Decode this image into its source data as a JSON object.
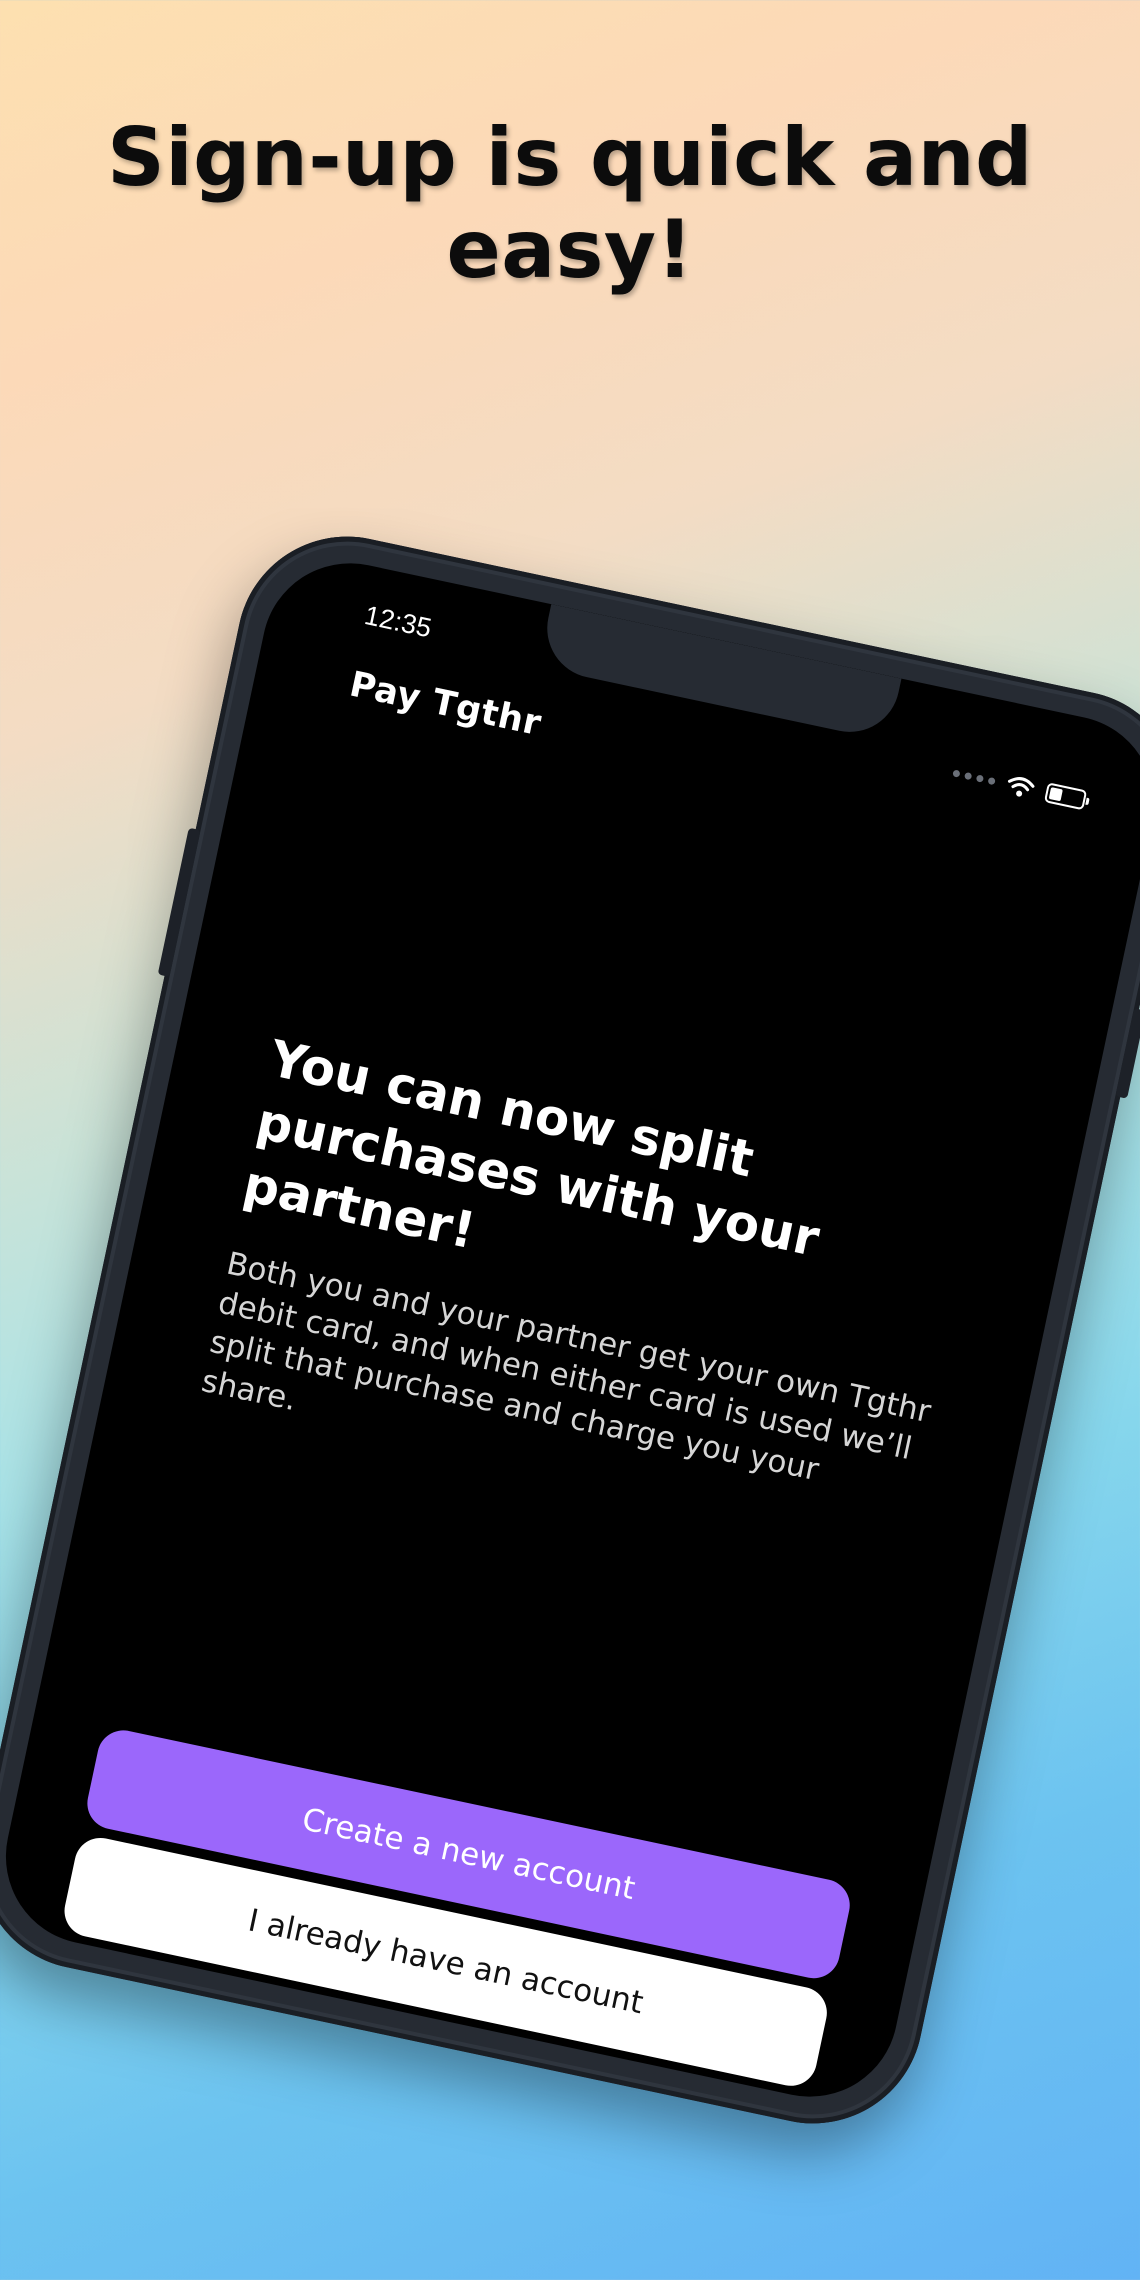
{
  "promo": {
    "headline": "Sign-up is quick and easy!"
  },
  "status_bar": {
    "time": "12:35",
    "icons": [
      "signal-dots-icon",
      "wifi-icon",
      "battery-icon"
    ]
  },
  "app": {
    "brand": "Pay Tgthr"
  },
  "onboarding": {
    "title": "You can now split purchases with your partner!",
    "description": "Both you and your partner get your own Tgthr debit card, and when either card is used we’ll split that purchase and charge you your share."
  },
  "actions": {
    "create_account": "Create a new account",
    "existing_account": "I already have an account"
  },
  "colors": {
    "accent": "#9B67FB",
    "screen_background": "#000000",
    "phone_frame": "#262B33"
  }
}
